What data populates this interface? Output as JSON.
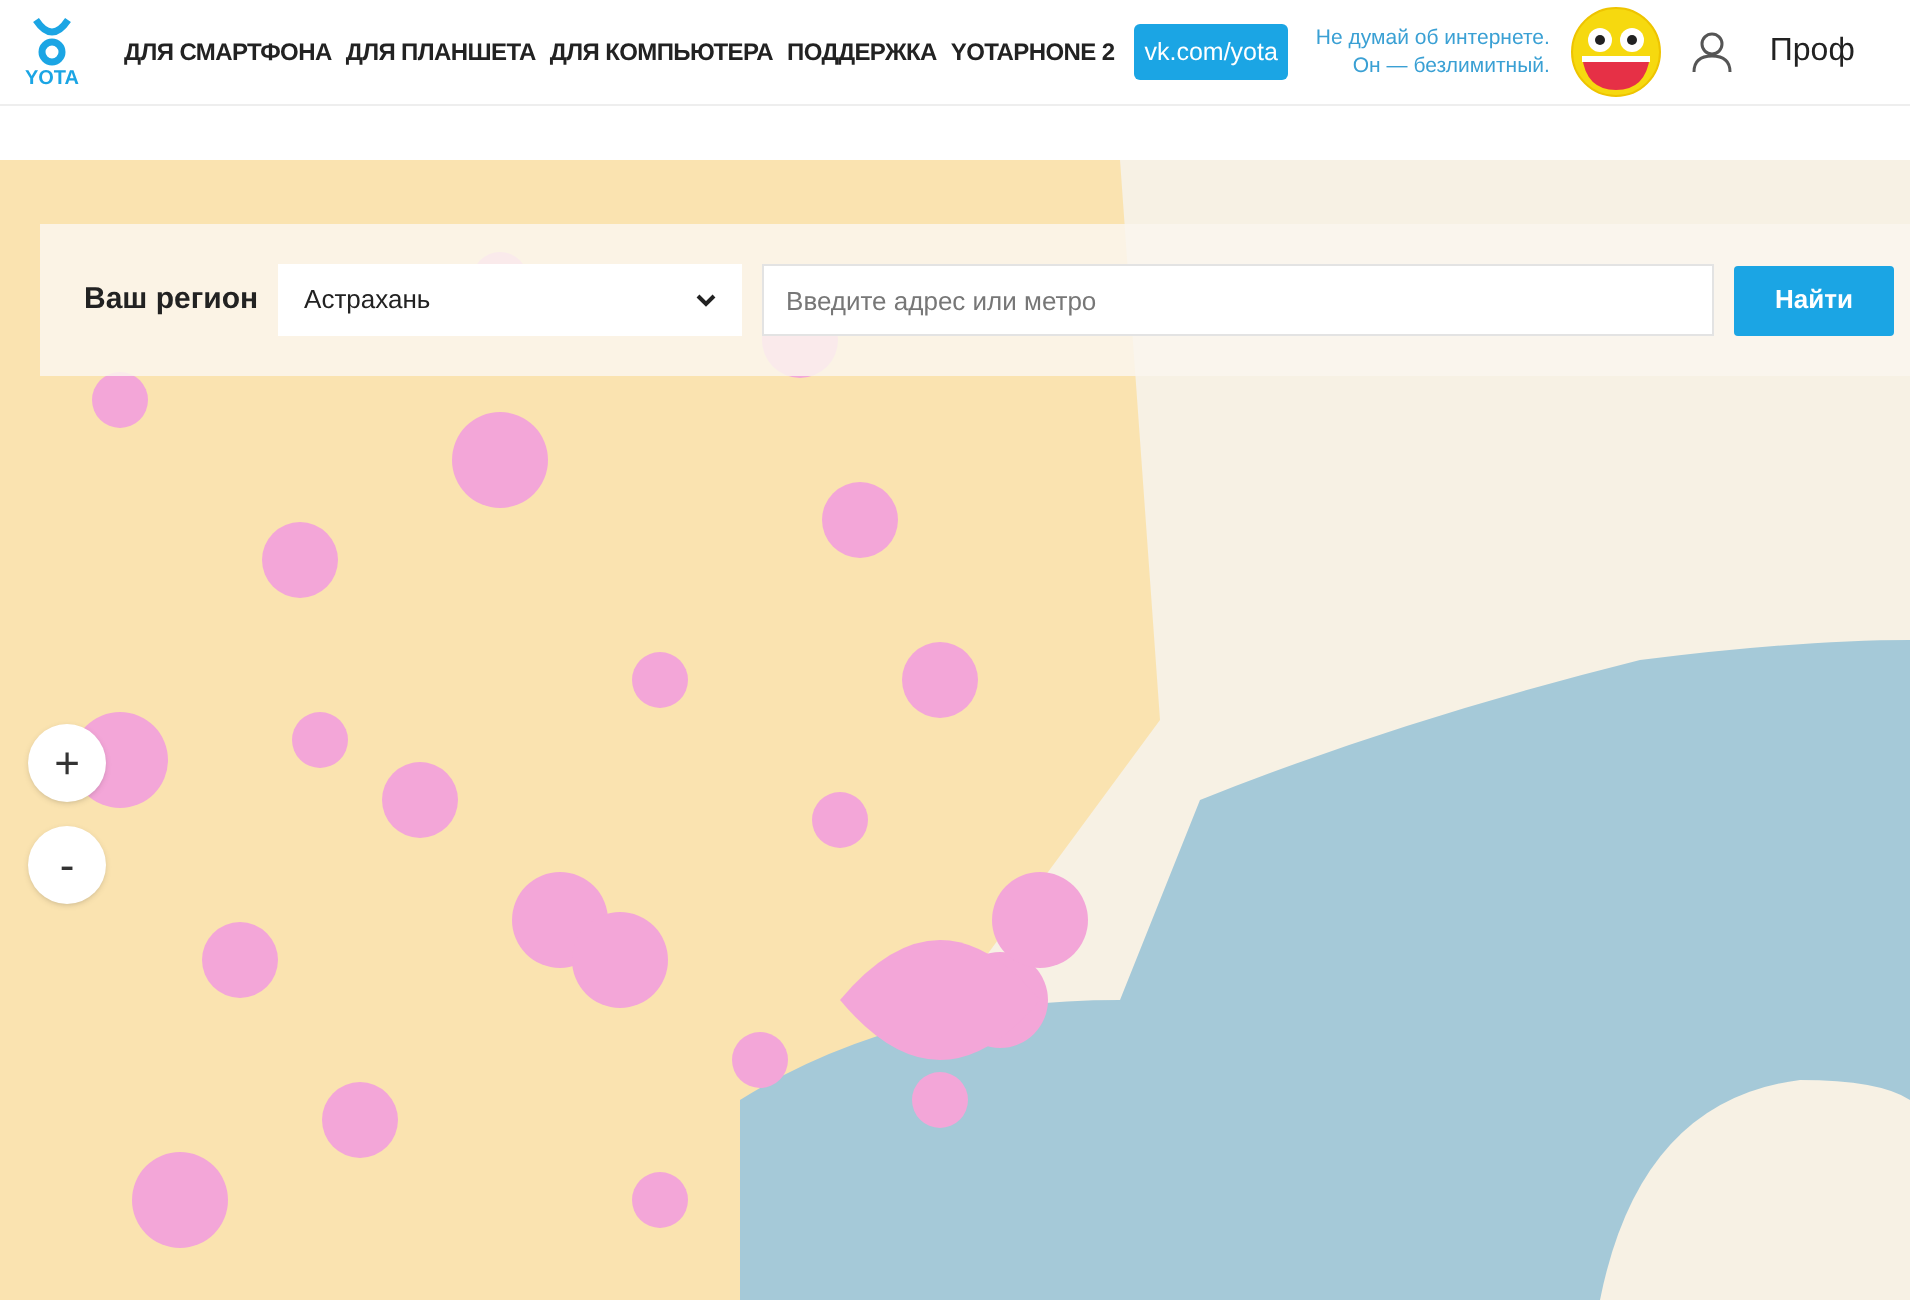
{
  "header": {
    "logo": "YOTA",
    "nav": [
      "ДЛЯ СМАРТФОНА",
      "ДЛЯ ПЛАНШЕТА",
      "ДЛЯ КОМПЬЮТЕРА",
      "ПОДДЕРЖКА",
      "YOTAPHONE 2"
    ],
    "vk_button": "vk.com/yota",
    "slogan": [
      "Не думай об интернете.",
      "Он — безлимитный."
    ],
    "profile": "Проф"
  },
  "search": {
    "region_label": "Ваш регион",
    "region_value": "Астрахань",
    "address_placeholder": "Введите адрес или метро",
    "submit": "Найти"
  },
  "zoom_controls": [
    "+",
    "-"
  ]
}
